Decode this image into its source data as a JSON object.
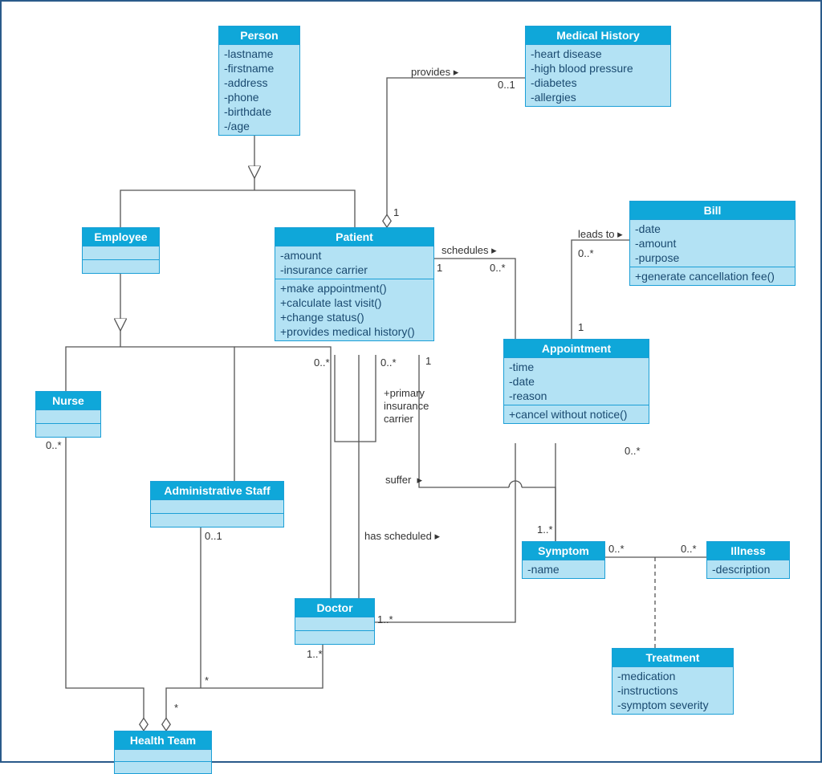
{
  "classes": {
    "person": {
      "title": "Person",
      "attrs": [
        "-lastname",
        "-firstname",
        "-address",
        "-phone",
        "-birthdate",
        "-/age"
      ],
      "ops": []
    },
    "medhist": {
      "title": "Medical History",
      "attrs": [
        "-heart disease",
        "-high blood pressure",
        "-diabetes",
        "-allergies"
      ],
      "ops": []
    },
    "employee": {
      "title": "Employee",
      "attrs": [],
      "ops": []
    },
    "patient": {
      "title": "Patient",
      "attrs": [
        "-amount",
        "-insurance carrier"
      ],
      "ops": [
        "+make appointment()",
        "+calculate last visit()",
        "+change status()",
        "+provides medical history()"
      ]
    },
    "bill": {
      "title": "Bill",
      "attrs": [
        "-date",
        "-amount",
        "-purpose"
      ],
      "ops": [
        "+generate cancellation fee()"
      ]
    },
    "appointment": {
      "title": "Appointment",
      "attrs": [
        "-time",
        "-date",
        "-reason"
      ],
      "ops": [
        "+cancel without notice()"
      ]
    },
    "nurse": {
      "title": "Nurse",
      "attrs": [],
      "ops": []
    },
    "admin": {
      "title": "Administrative Staff",
      "attrs": [],
      "ops": []
    },
    "doctor": {
      "title": "Doctor",
      "attrs": [],
      "ops": []
    },
    "symptom": {
      "title": "Symptom",
      "attrs": [
        "-name"
      ],
      "ops": []
    },
    "illness": {
      "title": "Illness",
      "attrs": [
        "-description"
      ],
      "ops": []
    },
    "treatment": {
      "title": "Treatment",
      "attrs": [
        "-medication",
        "-instructions",
        "-symptom severity"
      ],
      "ops": []
    },
    "healthteam": {
      "title": "Health Team",
      "attrs": [],
      "ops": []
    }
  },
  "labels": {
    "provides": "provides  ▸",
    "schedules": "schedules  ▸",
    "leadsto": "leads to  ▸",
    "suffer": "suffer  ▸",
    "hassched": "has scheduled  ▸",
    "primaryins": "+primary\ninsurance\ncarrier"
  },
  "mult": {
    "medhist_patient_top": "0..1",
    "patient_medhist_bottom": "1",
    "patient_sched_left": "1",
    "patient_sched_right": "0..*",
    "appt_bill_top": "0..*",
    "appt_bill_bottom": "1",
    "patient_self_left": "0..*",
    "patient_self_right": "0..*",
    "patient_bottom_1": "1",
    "appt_bottom": "0..*",
    "symptom_top": "1..*",
    "symptom_right": "0..*",
    "illness_left": "0..*",
    "nurse_bottom": "0..*",
    "admin_bottom": "0..1",
    "doctor_right": "1..*",
    "doctor_bottom": "1..*",
    "healthteam_star1": "*",
    "healthteam_star2": "*"
  }
}
